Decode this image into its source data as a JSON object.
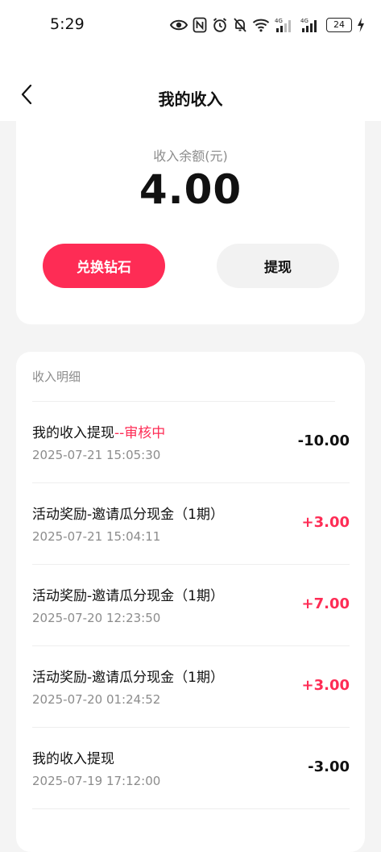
{
  "status_bar": {
    "time": "5:29",
    "battery": "24",
    "net_1": "4G",
    "net_2": "4G"
  },
  "nav": {
    "title": "我的收入"
  },
  "balance": {
    "label": "收入余额(元)",
    "value": "4.00"
  },
  "actions": {
    "exchange_label": "兑换钻石",
    "withdraw_label": "提现"
  },
  "details": {
    "header": "收入明细",
    "rows": [
      {
        "title": "我的收入提现",
        "status": "--审核中",
        "time": "2025-07-21 15:05:30",
        "amount": "-10.00"
      },
      {
        "title": "活动奖励-邀请瓜分现金（1期）",
        "status": "",
        "time": "2025-07-21 15:04:11",
        "amount": "+3.00"
      },
      {
        "title": "活动奖励-邀请瓜分现金（1期）",
        "status": "",
        "time": "2025-07-20 12:23:50",
        "amount": "+7.00"
      },
      {
        "title": "活动奖励-邀请瓜分现金（1期）",
        "status": "",
        "time": "2025-07-20 01:24:52",
        "amount": "+3.00"
      },
      {
        "title": "我的收入提现",
        "status": "",
        "time": "2025-07-19 17:12:00",
        "amount": "-3.00"
      }
    ]
  },
  "colors": {
    "accent": "#fe2c55",
    "page_bg": "#f4f4f4",
    "card_bg": "#ffffff",
    "secondary_text": "#8c8c8c"
  },
  "icons": {
    "back": "chevron-left-icon",
    "eye": "eye-icon",
    "nfc": "nfc-icon",
    "alarm": "alarm-icon",
    "mute": "bell-off-icon",
    "wifi": "wifi-icon",
    "signal": "signal-icon",
    "charging": "lightning-icon"
  }
}
